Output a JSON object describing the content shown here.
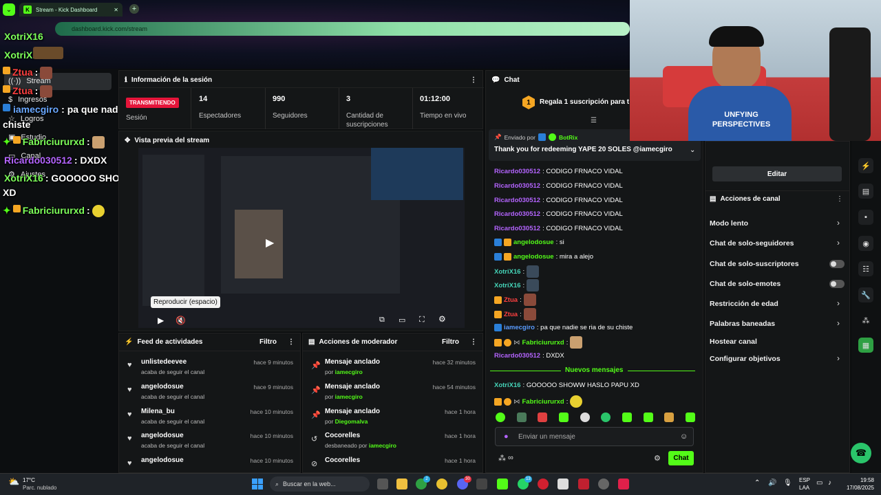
{
  "browser": {
    "tab_title": "Stream - Kick Dashboard",
    "url": "dashboard.kick.com/stream"
  },
  "leftnav": {
    "items": [
      {
        "label": "Stream"
      },
      {
        "label": "Ingresos"
      },
      {
        "label": "Logros"
      },
      {
        "label": "Estudio"
      },
      {
        "label": "Canal"
      },
      {
        "label": "Ajustes"
      }
    ]
  },
  "overlay_chat": [
    {
      "user": "XotriX16",
      "text": ""
    },
    {
      "user": "XotriX16",
      "text": ""
    },
    {
      "user": "Ztua",
      "text": ":"
    },
    {
      "user": "Ztua",
      "text": ":"
    },
    {
      "user": "iamecgiro",
      "text": ": pa que nadie se ria de su"
    },
    {
      "user": "",
      "text": "chiste"
    },
    {
      "user": "Fabriciururxd",
      "text": ":"
    },
    {
      "user": "Ricardo030512",
      "text": ": DXDX"
    },
    {
      "user": "XotriX16",
      "text": ": GOOOOO SHOWW HASLO PAPU"
    },
    {
      "user": "",
      "text": "XD"
    },
    {
      "user": "Fabriciururxd",
      "text": ":"
    }
  ],
  "session": {
    "title": "Información de la sesión",
    "live_badge": "TRANSMITIENDO",
    "session_label": "Sesión",
    "stats": [
      {
        "value": "14",
        "label": "Espectadores"
      },
      {
        "value": "990",
        "label": "Seguidores"
      },
      {
        "value": "3",
        "label": "Cantidad de suscripciones"
      },
      {
        "value": "01:12:00",
        "label": "Tiempo en vivo"
      }
    ]
  },
  "preview": {
    "title": "Vista previa del stream",
    "tooltip": "Reproducir (espacio)"
  },
  "feed": {
    "title": "Feed de actividades",
    "filter": "Filtro",
    "rows": [
      {
        "user": "unlistedeevee",
        "text": "acaba de seguir el canal",
        "time": "hace 9 minutos"
      },
      {
        "user": "angelodosue",
        "text": "acaba de seguir el canal",
        "time": "hace 9 minutos"
      },
      {
        "user": "Milena_bu",
        "text": "acaba de seguir el canal",
        "time": "hace 10 minutos"
      },
      {
        "user": "angelodosue",
        "text": "acaba de seguir el canal",
        "time": "hace 10 minutos"
      },
      {
        "user": "angelodosue",
        "text": "",
        "time": "hace 10 minutos"
      }
    ]
  },
  "mod": {
    "title": "Acciones de moderador",
    "filter": "Filtro",
    "rows": [
      {
        "title": "Mensaje anclado",
        "pre": "por",
        "who": "iamecgiro",
        "time": "hace 32 minutos"
      },
      {
        "title": "Mensaje anclado",
        "pre": "por",
        "who": "iamecgiro",
        "time": "hace 54 minutos"
      },
      {
        "title": "Mensaje anclado",
        "pre": "por",
        "who": "Diegomalva",
        "time": "hace 1 hora"
      },
      {
        "title": "Cocorelles",
        "pre": "desbaneado por",
        "who": "iamecgiro",
        "time": "hace 1 hora"
      },
      {
        "title": "Cocorelles",
        "pre": "",
        "who": "",
        "time": "hace 1 hora"
      }
    ]
  },
  "chat": {
    "title": "Chat",
    "gift_banner": "Regala 1 suscripción para tomar",
    "gift_count": "1",
    "pinned_sent_by": "Enviado por",
    "pinned_user": "BotRix",
    "pinned_text": "Thank you for redeeming YAPE 20 SOLES @iamecgiro",
    "new_messages": "Nuevos mensajes",
    "input_placeholder": "Enviar un mensaje",
    "send_button": "Chat",
    "messages": [
      {
        "user": "Ricardo030512",
        "text": ": CODIGO FRNACO VIDAL"
      },
      {
        "user": "Ricardo030512",
        "text": ": CODIGO FRNACO VIDAL"
      },
      {
        "user": "Ricardo030512",
        "text": ": CODIGO FRNACO VIDAL"
      },
      {
        "user": "Ricardo030512",
        "text": ": CODIGO FRNACO VIDAL"
      },
      {
        "user": "Ricardo030512",
        "text": ": CODIGO FRNACO VIDAL"
      },
      {
        "user": "angelodosue",
        "text": ": si"
      },
      {
        "user": "angelodosue",
        "text": ": mira a alejo"
      },
      {
        "user": "XotriX16",
        "text": ":"
      },
      {
        "user": "XotriX16",
        "text": ":"
      },
      {
        "user": "Ztua",
        "text": ":"
      },
      {
        "user": "Ztua",
        "text": ":"
      },
      {
        "user": "iamecgiro",
        "text": ": pa que nadie se ria de su chiste"
      },
      {
        "user": "Fabriciururxd",
        "text": ":"
      },
      {
        "user": "Ricardo030512",
        "text": ": DXDX"
      },
      {
        "user": "XotriX16",
        "text": ": GOOOOO SHOWW HASLO PAPU XD"
      },
      {
        "user": "Fabriciururxd",
        "text": ":"
      }
    ]
  },
  "channel": {
    "edit_button": "Editar",
    "actions_title": "Acciones de canal",
    "items": [
      {
        "label": "Modo lento"
      },
      {
        "label": "Chat de solo-seguidores"
      },
      {
        "label": "Chat de solo-suscriptores"
      },
      {
        "label": "Chat de solo-emotes"
      },
      {
        "label": "Restricción de edad"
      },
      {
        "label": "Palabras baneadas"
      },
      {
        "label": "Hostear canal"
      },
      {
        "label": "Configurar objetivos"
      }
    ]
  },
  "webcam": {
    "shirt_text": "UNFYING PERSPECTIVES"
  },
  "taskbar": {
    "temp": "17°C",
    "weather": "Parc. nublado",
    "search_placeholder": "Buscar en la web...",
    "lang": "ESP",
    "lang2": "LAA",
    "time": "19:58",
    "date": "17/08/2025",
    "badge_xbox": "2",
    "badge_discord": "30",
    "badge_whatsapp": "13"
  },
  "colors": {
    "kick_green": "#53fc18",
    "live_red": "#e5153a",
    "panel": "#141617"
  }
}
